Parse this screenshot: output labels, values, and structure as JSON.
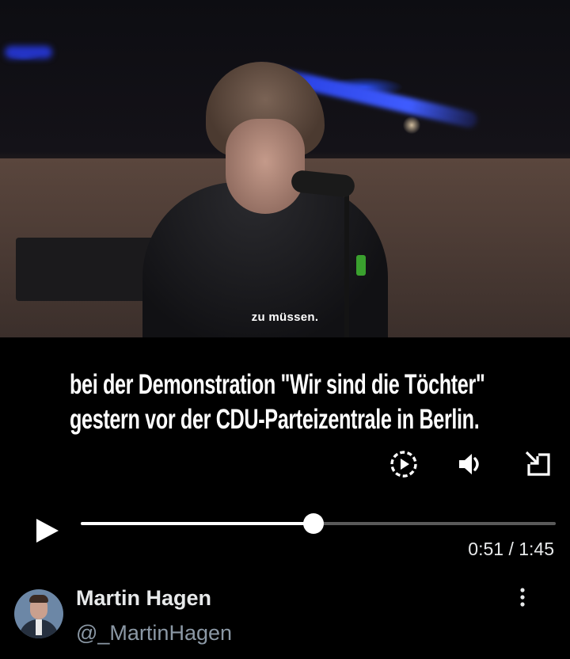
{
  "video": {
    "burned_subtitle": "zu müssen.",
    "caption_lines": [
      "bei der Demonstration \"Wir sind die Töchter\"",
      "gestern vor der CDU-Parteizentrale in Berlin."
    ],
    "controls": {
      "replay_icon": "replay-circle-icon",
      "volume_icon": "speaker-volume-icon",
      "fullscreen_icon": "expand-pip-icon"
    },
    "player": {
      "play_icon": "play-icon",
      "progress_fraction": 0.49,
      "time_display": "0:51 / 1:45"
    }
  },
  "author": {
    "name": "Martin Hagen",
    "handle": "@_MartinHagen",
    "more_icon": "more-vertical-icon"
  }
}
